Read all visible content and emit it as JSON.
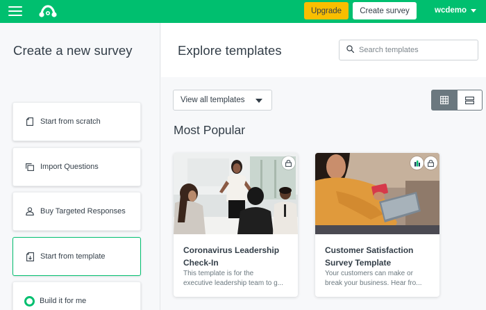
{
  "topbar": {
    "upgrade_label": "Upgrade",
    "create_label": "Create survey",
    "username": "wcdemo"
  },
  "left": {
    "title": "Create a new survey",
    "options": [
      {
        "label": "Start from scratch",
        "icon": "document-icon"
      },
      {
        "label": "Import Questions",
        "icon": "copy-icon"
      },
      {
        "label": "Buy Targeted Responses",
        "icon": "person-icon"
      },
      {
        "label": "Start from template",
        "icon": "template-icon"
      },
      {
        "label": "Build it for me",
        "icon": "ring-icon"
      }
    ]
  },
  "right": {
    "title": "Explore templates",
    "search_placeholder": "Search templates",
    "filter_label": "View all templates",
    "section_title": "Most Popular",
    "cards": [
      {
        "title_line1": "Coronavirus Leadership",
        "title_line2": "Check-In",
        "desc_line1": "This template is for the",
        "desc_line2": "executive leadership team to g..."
      },
      {
        "title_line1": "Customer Satisfaction",
        "title_line2": "Survey Template",
        "desc_line1": "Your customers can make or",
        "desc_line2": "break your business. Hear fro..."
      }
    ]
  },
  "colors": {
    "brand_green": "#00bf6f",
    "upgrade_yellow": "#f9be00",
    "text": "#333e48"
  }
}
